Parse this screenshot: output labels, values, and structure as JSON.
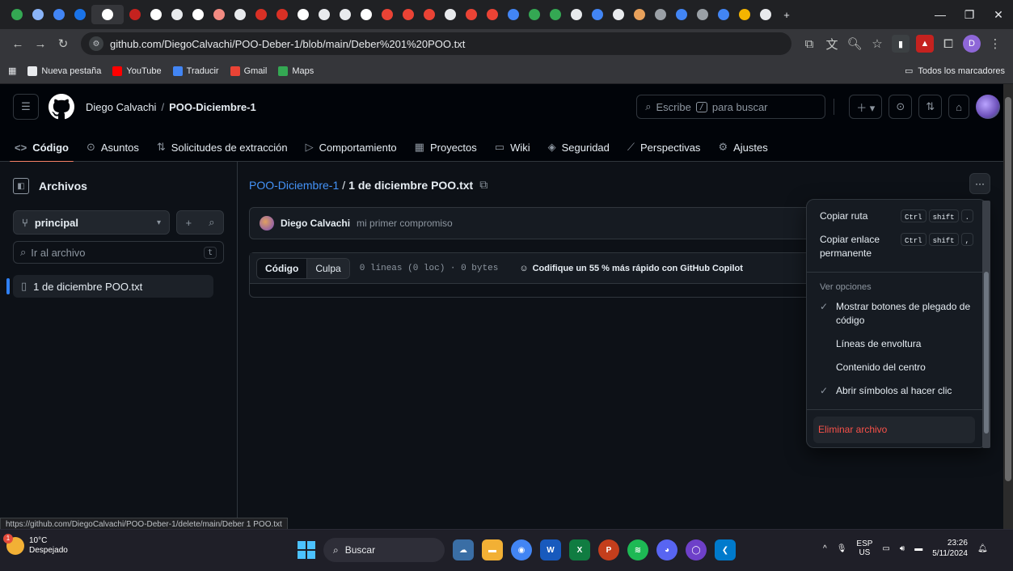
{
  "browser": {
    "url": "github.com/DiegoCalvachi/POO-Deber-1/blob/main/Deber%201%20POO.txt",
    "tab_colors": [
      "#34a853",
      "#8ab4f8",
      "#4285f4",
      "#1a73e8",
      "#fff",
      "#c5221f",
      "#fff",
      "#e8eaed",
      "#fff",
      "#f28b82",
      "#e8eaed",
      "#d93025",
      "#d93025",
      "#fff",
      "#e8eaed",
      "#e8eaed",
      "#fff",
      "#ea4335",
      "#ea4335",
      "#ea4335",
      "#e8eaed",
      "#ea4335",
      "#ea4335",
      "#4285f4",
      "#34a853",
      "#34a853",
      "#e8eaed",
      "#4285f4",
      "#e8eaed",
      "#e8a15b",
      "#9aa0a6",
      "#4285f4",
      "#9aa0a6",
      "#4285f4",
      "#f4b400",
      "#e8eaed"
    ],
    "bookmarks": [
      {
        "label": "Nueva pestaña",
        "color": "#e8eaed"
      },
      {
        "label": "YouTube",
        "color": "#ff0000"
      },
      {
        "label": "Traducir",
        "color": "#4285f4"
      },
      {
        "label": "Gmail",
        "color": "#ea4335"
      },
      {
        "label": "Maps",
        "color": "#34a853"
      }
    ],
    "all_bookmarks": "Todos los marcadores"
  },
  "github": {
    "owner": "Diego Calvachi",
    "repo": "POO-Diciembre-1",
    "search_prefix": "Escribe",
    "search_key": "/",
    "search_suffix": "para buscar",
    "nav": [
      {
        "icon": "<>",
        "label": "Código",
        "active": true
      },
      {
        "icon": "⊙",
        "label": "Asuntos"
      },
      {
        "icon": "⇅",
        "label": "Solicitudes de extracción"
      },
      {
        "icon": "▷",
        "label": "Comportamiento"
      },
      {
        "icon": "▦",
        "label": "Proyectos"
      },
      {
        "icon": "▭",
        "label": "Wiki"
      },
      {
        "icon": "◈",
        "label": "Seguridad"
      },
      {
        "icon": "⟋",
        "label": "Perspectivas"
      },
      {
        "icon": "⚙",
        "label": "Ajustes"
      }
    ]
  },
  "sidebar": {
    "title": "Archivos",
    "branch": "principal",
    "goto_placeholder": "Ir al archivo",
    "goto_key": "t",
    "file": "1 de diciembre POO.txt"
  },
  "main": {
    "repo_link": "POO-Diciembre-1",
    "file_name": "1 de diciembre POO.txt",
    "commit_author": "Diego Calvachi",
    "commit_message": "mi primer compromiso",
    "tab_code": "Código",
    "tab_blame": "Culpa",
    "file_meta": "0 líneas (0 loc) · 0 bytes",
    "copilot": "Codifique un 55 % más rápido con GitHub Copilot"
  },
  "menu": {
    "copy_path": "Copiar ruta",
    "copy_path_keys": [
      "Ctrl",
      "shift",
      "."
    ],
    "copy_link": "Copiar enlace permanente",
    "copy_link_keys": [
      "Ctrl",
      "shift",
      ","
    ],
    "view_options": "Ver opciones",
    "opt1": "Mostrar botones de plegado de código",
    "opt2": "Líneas de envoltura",
    "opt3": "Contenido del centro",
    "opt4": "Abrir símbolos al hacer clic",
    "delete": "Eliminar archivo"
  },
  "status_url": "https://github.com/DiegoCalvachi/POO-Deber-1/delete/main/Deber 1 POO.txt",
  "taskbar": {
    "temp": "10°C",
    "weather": "Despejado",
    "weather_badge": "1",
    "search": "Buscar",
    "lang1": "ESP",
    "lang2": "US",
    "time": "23:26",
    "date": "5/11/2024"
  }
}
